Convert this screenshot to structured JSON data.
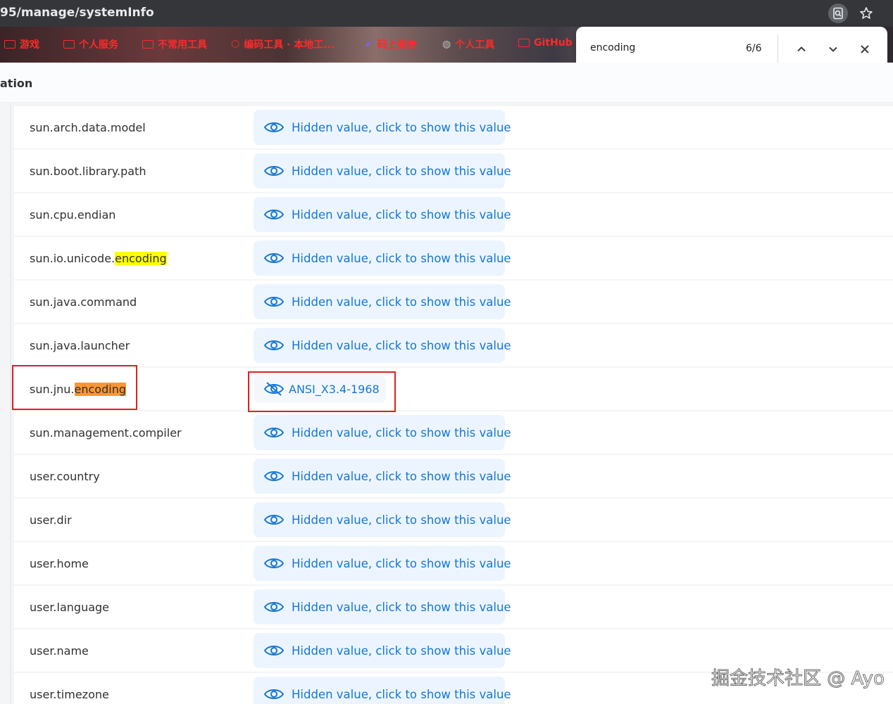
{
  "address_bar": {
    "url": "95/manage/systemInfo"
  },
  "toolbar": {
    "lens_icon": "search-page-icon",
    "star_icon": "star-icon"
  },
  "bookmarks": [
    {
      "label": "游戏",
      "icon": "folder-icon"
    },
    {
      "label": "个人服务",
      "icon": "folder-icon"
    },
    {
      "label": "不常用工具",
      "icon": "folder-icon"
    },
    {
      "label": "编码工具 · 本地工...",
      "icon": "codepen-icon"
    },
    {
      "label": "码上掘金",
      "icon": "juejin-icon"
    },
    {
      "label": "个人工具",
      "icon": "globe-icon"
    },
    {
      "label": "GitHub",
      "icon": "folder-icon"
    }
  ],
  "find_bar": {
    "query": "encoding",
    "count": "6/6"
  },
  "page": {
    "title_fragment": "ation"
  },
  "properties": [
    {
      "key_prefix": "sun.arch.data.model",
      "key_match": "",
      "value": "Hidden value, click to show this value",
      "shown": false
    },
    {
      "key_prefix": "sun.boot.library.path",
      "key_match": "",
      "value": "Hidden value, click to show this value",
      "shown": false
    },
    {
      "key_prefix": "sun.cpu.endian",
      "key_match": "",
      "value": "Hidden value, click to show this value",
      "shown": false
    },
    {
      "key_prefix": "sun.io.unicode.",
      "key_match": "encoding",
      "value": "Hidden value, click to show this value",
      "shown": false,
      "active": false
    },
    {
      "key_prefix": "sun.java.command",
      "key_match": "",
      "value": "Hidden value, click to show this value",
      "shown": false
    },
    {
      "key_prefix": "sun.java.launcher",
      "key_match": "",
      "value": "Hidden value, click to show this value",
      "shown": false
    },
    {
      "key_prefix": "sun.jnu.",
      "key_match": "encoding",
      "value": "ANSI_X3.4-1968",
      "shown": true,
      "active": true
    },
    {
      "key_prefix": "sun.management.compiler",
      "key_match": "",
      "value": "Hidden value, click to show this value",
      "shown": false
    },
    {
      "key_prefix": "user.country",
      "key_match": "",
      "value": "Hidden value, click to show this value",
      "shown": false
    },
    {
      "key_prefix": "user.dir",
      "key_match": "",
      "value": "Hidden value, click to show this value",
      "shown": false
    },
    {
      "key_prefix": "user.home",
      "key_match": "",
      "value": "Hidden value, click to show this value",
      "shown": false
    },
    {
      "key_prefix": "user.language",
      "key_match": "",
      "value": "Hidden value, click to show this value",
      "shown": false
    },
    {
      "key_prefix": "user.name",
      "key_match": "",
      "value": "Hidden value, click to show this value",
      "shown": false
    },
    {
      "key_prefix": "user.timezone",
      "key_match": "",
      "value": "Hidden value, click to show this value",
      "shown": false
    }
  ],
  "watermark": "掘金技术社区 @ Ayo",
  "colors": {
    "highlight": "#ffff00",
    "active_highlight": "#ff9632",
    "link": "#1677d2",
    "annotation": "#e02020"
  }
}
